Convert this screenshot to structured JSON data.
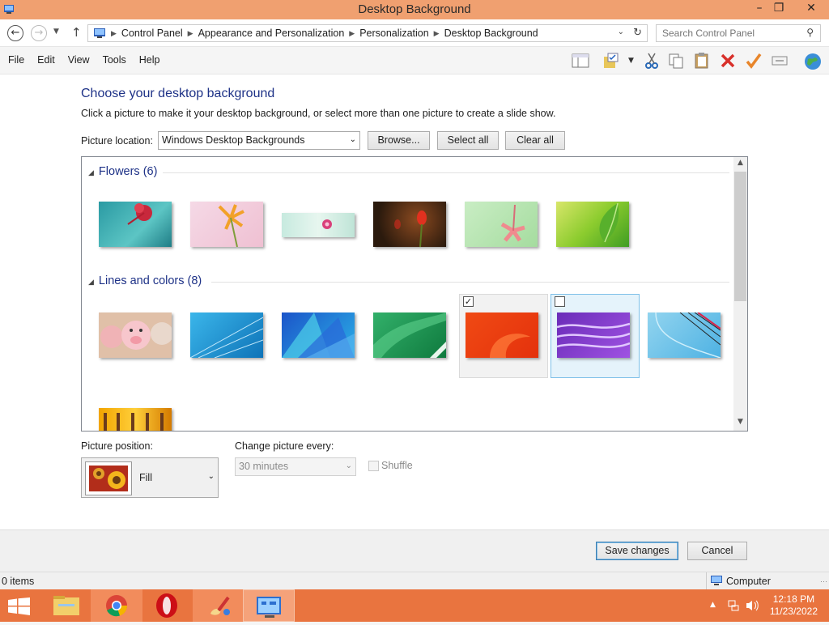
{
  "window": {
    "title": "Desktop Background"
  },
  "address": {
    "crumbs": [
      "Control Panel",
      "Appearance and Personalization",
      "Personalization",
      "Desktop Background"
    ],
    "search_placeholder": "Search Control Panel"
  },
  "menu": [
    "File",
    "Edit",
    "View",
    "Tools",
    "Help"
  ],
  "page": {
    "heading": "Choose your desktop background",
    "subheading": "Click a picture to make it your desktop background, or select more than one picture to create a slide show.",
    "location_label": "Picture location:",
    "location_value": "Windows Desktop Backgrounds",
    "browse": "Browse...",
    "select_all": "Select all",
    "clear_all": "Clear all"
  },
  "groups": [
    {
      "label": "Flowers (6)",
      "count": 6
    },
    {
      "label": "Lines and colors (8)",
      "count": 8
    }
  ],
  "selection": {
    "lines_tile_5_checked": true,
    "lines_tile_6_checked": false
  },
  "position": {
    "label": "Picture position:",
    "value": "Fill",
    "interval_label": "Change picture every:",
    "interval_value": "30 minutes",
    "shuffle_label": "Shuffle",
    "shuffle_checked": false
  },
  "actions": {
    "save": "Save changes",
    "cancel": "Cancel"
  },
  "status": {
    "items": "0 items",
    "location": "Computer"
  },
  "clock": {
    "time": "12:18 PM",
    "date": "11/23/2022"
  }
}
